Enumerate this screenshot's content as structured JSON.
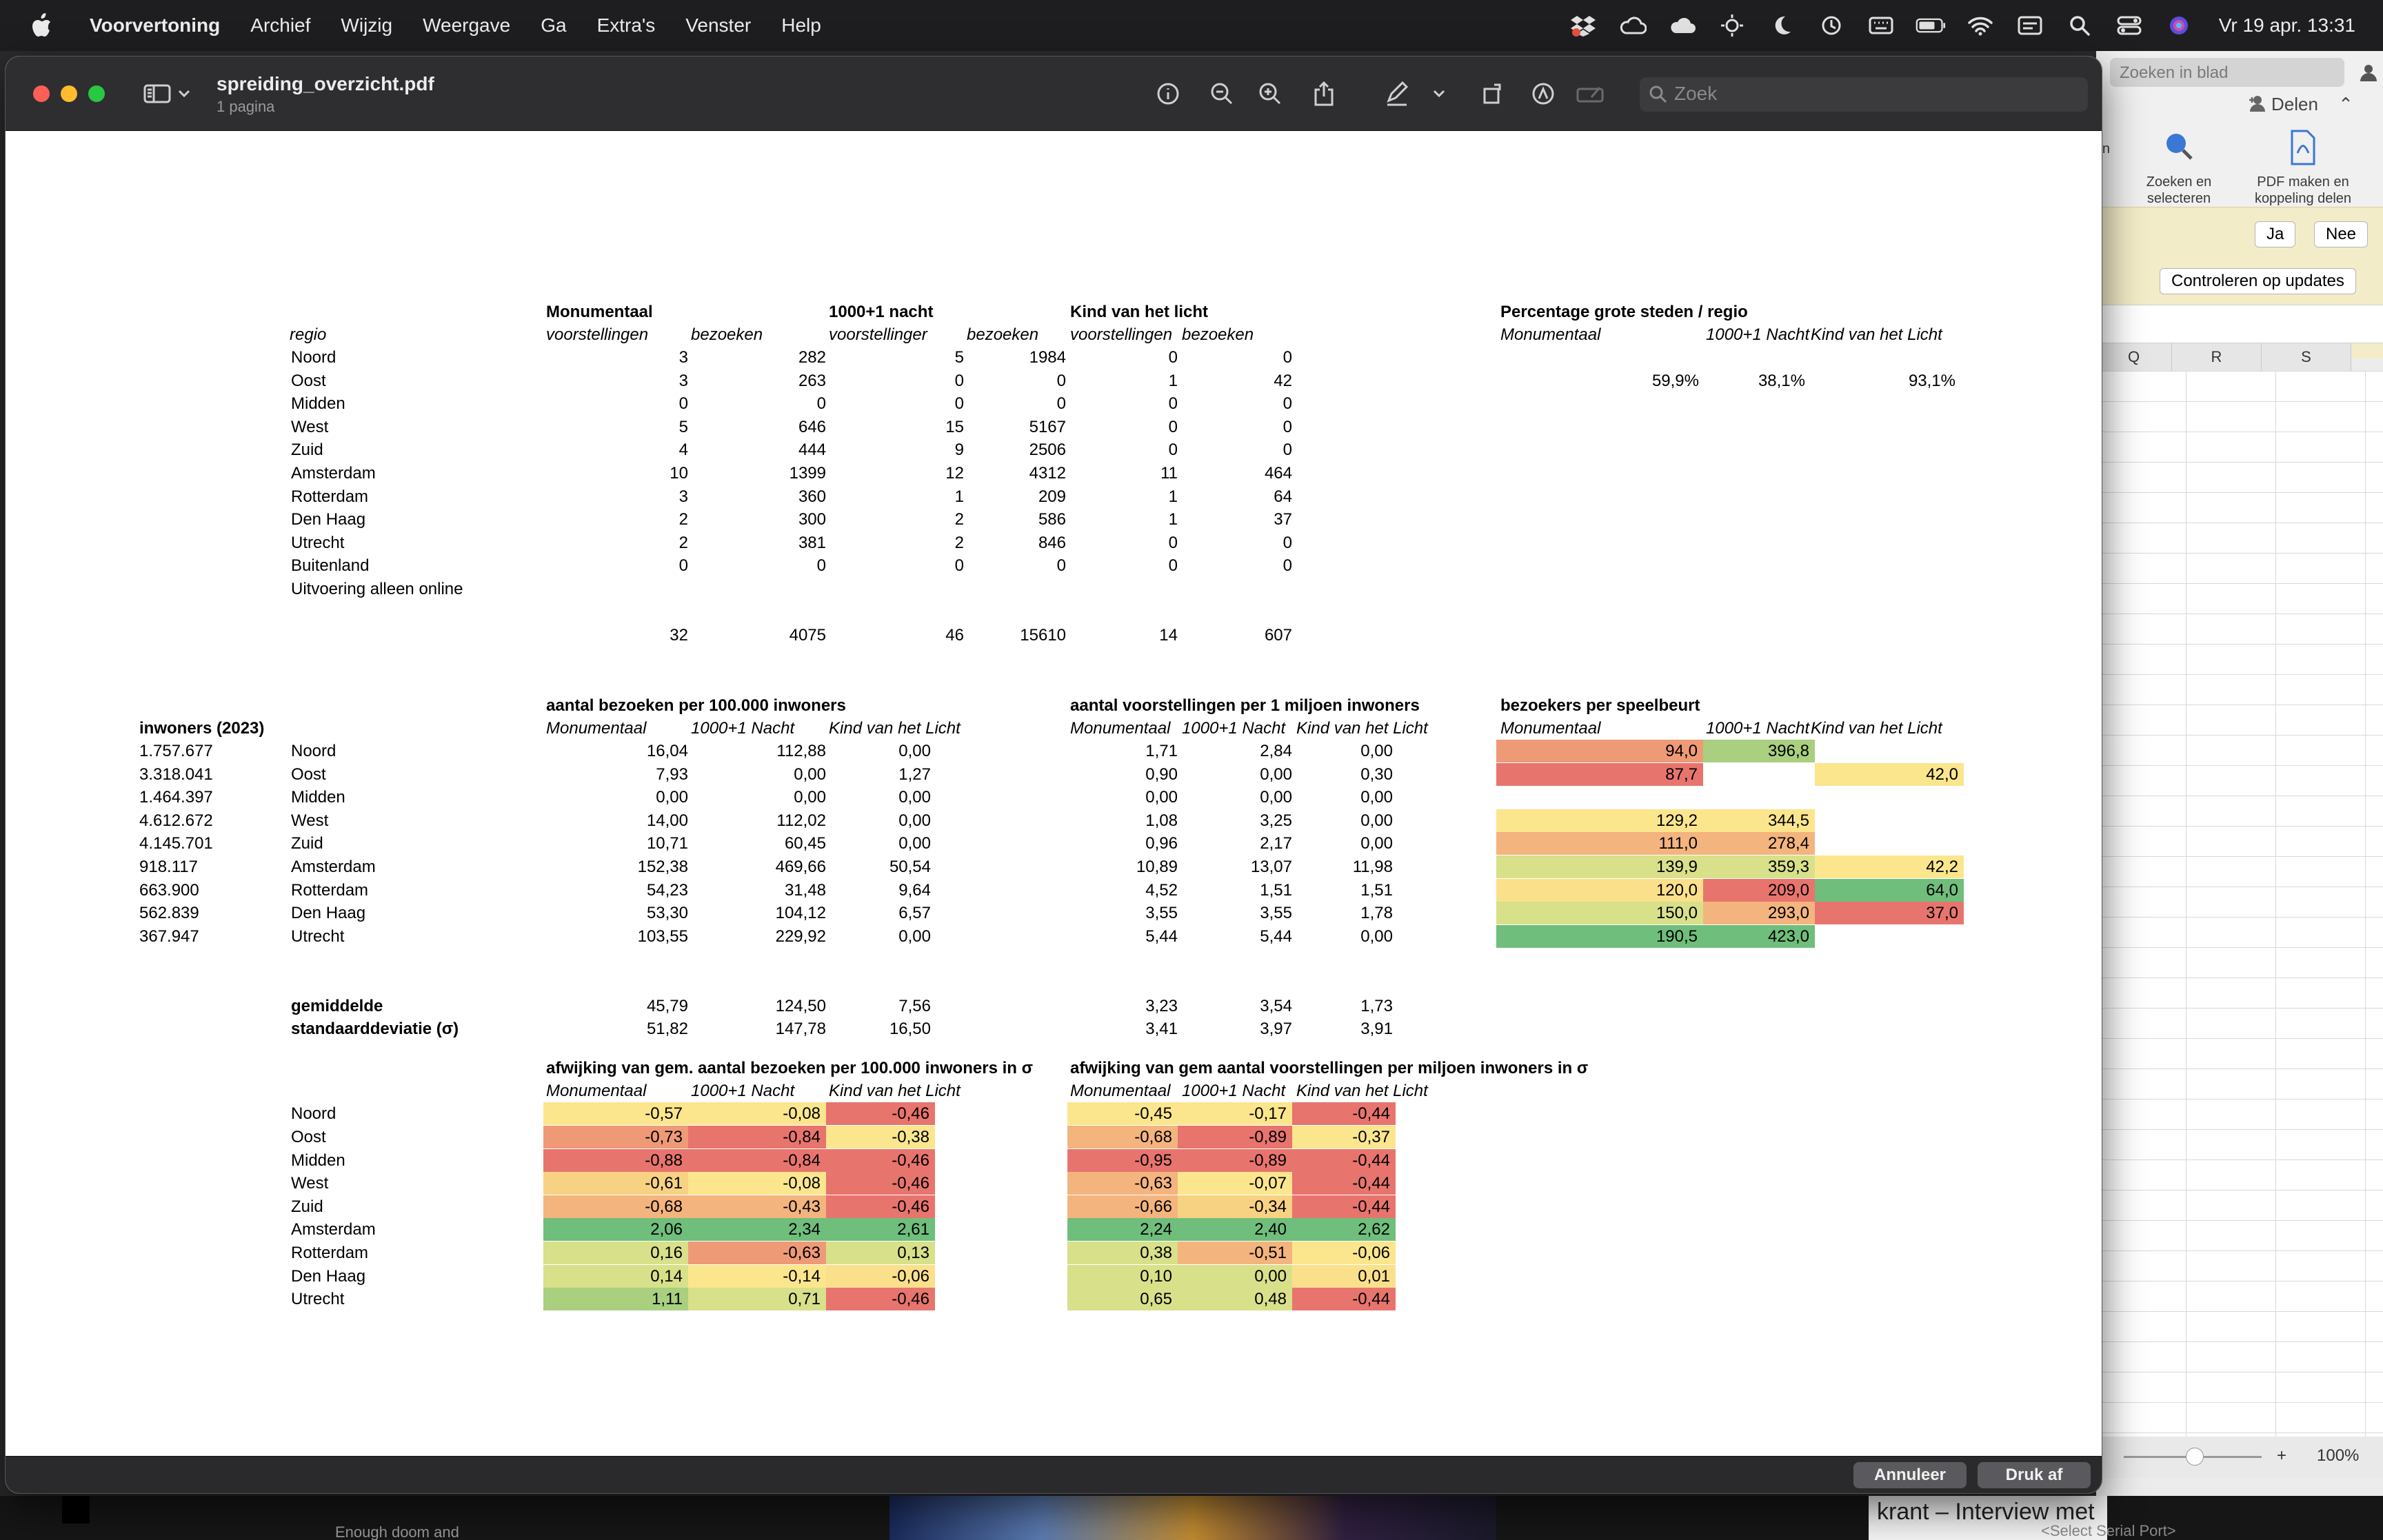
{
  "menubar": {
    "app": "Voorvertoning",
    "items": [
      "Archief",
      "Wijzig",
      "Weergave",
      "Ga",
      "Extra's",
      "Venster",
      "Help"
    ],
    "clock": "Vr 19 apr.  13:31"
  },
  "window": {
    "title": "spreiding_overzicht.pdf",
    "subtitle": "1 pagina",
    "search_placeholder": "Zoek"
  },
  "footer": {
    "cancel": "Annuleer",
    "print": "Druk af"
  },
  "background_excel": {
    "search": "Zoeken in blad",
    "share": "Delen",
    "ribbon_items": [
      "Zoeken en selecteren",
      "PDF maken en koppeling delen"
    ],
    "ribbon_partial": "en ren",
    "yes": "Ja",
    "no": "Nee",
    "update_button": "Controleren op updates",
    "columns": [
      "Q",
      "R",
      "S"
    ],
    "zoom": "100%"
  },
  "background_bottom": {
    "left_text": "Enough doom and",
    "news_text": "krant – Interview met",
    "serial": "<Select Serial Port>"
  },
  "sheet": {
    "top": {
      "group_headers": [
        "Monumentaal",
        "1000+1 nacht",
        "Kind van het licht"
      ],
      "sub_headers": [
        "regio",
        "voorstellingen",
        "bezoeken",
        "voorstellinger",
        "bezoeken",
        "voorstellingen",
        "bezoeken"
      ],
      "rows": [
        {
          "regio": "Noord",
          "v": [
            "3",
            "282",
            "5",
            "1984",
            "0",
            "0"
          ]
        },
        {
          "regio": "Oost",
          "v": [
            "3",
            "263",
            "0",
            "0",
            "1",
            "42"
          ]
        },
        {
          "regio": "Midden",
          "v": [
            "0",
            "0",
            "0",
            "0",
            "0",
            "0"
          ]
        },
        {
          "regio": "West",
          "v": [
            "5",
            "646",
            "15",
            "5167",
            "0",
            "0"
          ]
        },
        {
          "regio": "Zuid",
          "v": [
            "4",
            "444",
            "9",
            "2506",
            "0",
            "0"
          ]
        },
        {
          "regio": "Amsterdam",
          "v": [
            "10",
            "1399",
            "12",
            "4312",
            "11",
            "464"
          ]
        },
        {
          "regio": "Rotterdam",
          "v": [
            "3",
            "360",
            "1",
            "209",
            "1",
            "64"
          ]
        },
        {
          "regio": "Den Haag",
          "v": [
            "2",
            "300",
            "2",
            "586",
            "1",
            "37"
          ]
        },
        {
          "regio": "Utrecht",
          "v": [
            "2",
            "381",
            "2",
            "846",
            "0",
            "0"
          ]
        },
        {
          "regio": "Buitenland",
          "v": [
            "0",
            "0",
            "0",
            "0",
            "0",
            "0"
          ]
        },
        {
          "regio": "Uitvoering alleen online",
          "v": [
            "",
            "",
            "",
            "",
            "",
            ""
          ]
        }
      ],
      "totals": [
        "32",
        "4075",
        "46",
        "15610",
        "14",
        "607"
      ]
    },
    "pct": {
      "title": "Percentage grote steden / regio",
      "headers": [
        "Monumentaal",
        "1000+1 Nacht",
        "Kind van het Licht"
      ],
      "values": [
        "59,9%",
        "38,1%",
        "93,1%"
      ]
    },
    "mid": {
      "inwoners_header": "inwoners (2023)",
      "bezoeken_title": "aantal bezoeken per 100.000 inwoners",
      "voorst_title": "aantal voorstellingen per 1 miljoen inwoners",
      "speelbeurt_title": "bezoekers per speelbeurt",
      "col_headers": [
        "Monumentaal",
        "1000+1 Nacht",
        "Kind van het Licht"
      ],
      "rows": [
        {
          "inw": "1.757.677",
          "regio": "Noord",
          "b": [
            "16,04",
            "112,88",
            "0,00"
          ],
          "v": [
            "1,71",
            "2,84",
            "0,00"
          ],
          "s": [
            "94,0",
            "396,8",
            ""
          ]
        },
        {
          "inw": "3.318.041",
          "regio": "Oost",
          "b": [
            "7,93",
            "0,00",
            "1,27"
          ],
          "v": [
            "0,90",
            "0,00",
            "0,30"
          ],
          "s": [
            "87,7",
            "",
            "42,0"
          ]
        },
        {
          "inw": "1.464.397",
          "regio": "Midden",
          "b": [
            "0,00",
            "0,00",
            "0,00"
          ],
          "v": [
            "0,00",
            "0,00",
            "0,00"
          ],
          "s": [
            "",
            "",
            ""
          ]
        },
        {
          "inw": "4.612.672",
          "regio": "West",
          "b": [
            "14,00",
            "112,02",
            "0,00"
          ],
          "v": [
            "1,08",
            "3,25",
            "0,00"
          ],
          "s": [
            "129,2",
            "344,5",
            ""
          ]
        },
        {
          "inw": "4.145.701",
          "regio": "Zuid",
          "b": [
            "10,71",
            "60,45",
            "0,00"
          ],
          "v": [
            "0,96",
            "2,17",
            "0,00"
          ],
          "s": [
            "111,0",
            "278,4",
            ""
          ]
        },
        {
          "inw": "918.117",
          "regio": "Amsterdam",
          "b": [
            "152,38",
            "469,66",
            "50,54"
          ],
          "v": [
            "10,89",
            "13,07",
            "11,98"
          ],
          "s": [
            "139,9",
            "359,3",
            "42,2"
          ]
        },
        {
          "inw": "663.900",
          "regio": "Rotterdam",
          "b": [
            "54,23",
            "31,48",
            "9,64"
          ],
          "v": [
            "4,52",
            "1,51",
            "1,51"
          ],
          "s": [
            "120,0",
            "209,0",
            "64,0"
          ]
        },
        {
          "inw": "562.839",
          "regio": "Den Haag",
          "b": [
            "53,30",
            "104,12",
            "6,57"
          ],
          "v": [
            "3,55",
            "3,55",
            "1,78"
          ],
          "s": [
            "150,0",
            "293,0",
            "37,0"
          ]
        },
        {
          "inw": "367.947",
          "regio": "Utrecht",
          "b": [
            "103,55",
            "229,92",
            "0,00"
          ],
          "v": [
            "5,44",
            "5,44",
            "0,00"
          ],
          "s": [
            "190,5",
            "423,0",
            ""
          ]
        }
      ],
      "s_colors": [
        [
          "#ef9a77",
          "#a9cf7f",
          null
        ],
        [
          "#e8746e",
          null,
          "#fbe68e"
        ],
        [
          null,
          null,
          null
        ],
        [
          "#fbe68e",
          "#fbe68e",
          null
        ],
        [
          "#f4b47e",
          "#f4b47e",
          null
        ],
        [
          "#d8e08a",
          "#d8e08a",
          "#fbe68e"
        ],
        [
          "#fbe08c",
          "#e8746e",
          "#6fbe7c"
        ],
        [
          "#d8e08a",
          "#f4b47e",
          "#e8746e"
        ],
        [
          "#6fbe7c",
          "#6fbe7c",
          null
        ]
      ],
      "avg_label": "gemiddelde",
      "std_label": "standaarddeviatie (σ)",
      "avg_b": [
        "45,79",
        "124,50",
        "7,56"
      ],
      "avg_v": [
        "3,23",
        "3,54",
        "1,73"
      ],
      "std_b": [
        "51,82",
        "147,78",
        "16,50"
      ],
      "std_v": [
        "3,41",
        "3,97",
        "3,91"
      ]
    },
    "dev": {
      "title_b": "afwijking van gem. aantal bezoeken per 100.000 inwoners in σ",
      "title_v": "afwijking van gem aantal voorstellingen per miljoen inwoners in σ",
      "col_headers": [
        "Monumentaal",
        "1000+1 Nacht",
        "Kind van het Licht"
      ],
      "regios": [
        "Noord",
        "Oost",
        "Midden",
        "West",
        "Zuid",
        "Amsterdam",
        "Rotterdam",
        "Den Haag",
        "Utrecht"
      ],
      "b": [
        [
          "-0,57",
          "-0,08",
          "-0,46"
        ],
        [
          "-0,73",
          "-0,84",
          "-0,38"
        ],
        [
          "-0,88",
          "-0,84",
          "-0,46"
        ],
        [
          "-0,61",
          "-0,08",
          "-0,46"
        ],
        [
          "-0,68",
          "-0,43",
          "-0,46"
        ],
        [
          "2,06",
          "2,34",
          "2,61"
        ],
        [
          "0,16",
          "-0,63",
          "0,13"
        ],
        [
          "0,14",
          "-0,14",
          "-0,06"
        ],
        [
          "1,11",
          "0,71",
          "-0,46"
        ]
      ],
      "v": [
        [
          "-0,45",
          "-0,17",
          "-0,44"
        ],
        [
          "-0,68",
          "-0,89",
          "-0,37"
        ],
        [
          "-0,95",
          "-0,89",
          "-0,44"
        ],
        [
          "-0,63",
          "-0,07",
          "-0,44"
        ],
        [
          "-0,66",
          "-0,34",
          "-0,44"
        ],
        [
          "2,24",
          "2,40",
          "2,62"
        ],
        [
          "0,38",
          "-0,51",
          "-0,06"
        ],
        [
          "0,10",
          "0,00",
          "0,01"
        ],
        [
          "0,65",
          "0,48",
          "-0,44"
        ]
      ],
      "b_colors": [
        [
          "#fbe68e",
          "#fbe68e",
          "#e8746e"
        ],
        [
          "#ef9a77",
          "#e8746e",
          "#fbe68e"
        ],
        [
          "#e8746e",
          "#e8746e",
          "#e8746e"
        ],
        [
          "#f8d283",
          "#fbe68e",
          "#e8746e"
        ],
        [
          "#f4b47e",
          "#f4b47e",
          "#e8746e"
        ],
        [
          "#6fbe7c",
          "#6fbe7c",
          "#6fbe7c"
        ],
        [
          "#d8e08a",
          "#ef9a77",
          "#d8e08a"
        ],
        [
          "#d8e08a",
          "#fbe68e",
          "#fbe08c"
        ],
        [
          "#a9cf7f",
          "#d8e08a",
          "#e8746e"
        ]
      ],
      "v_colors": [
        [
          "#fbe68e",
          "#fbe68e",
          "#e8746e"
        ],
        [
          "#f4b47e",
          "#e8746e",
          "#fbe68e"
        ],
        [
          "#e8746e",
          "#e8746e",
          "#e8746e"
        ],
        [
          "#f4b47e",
          "#fbe68e",
          "#e8746e"
        ],
        [
          "#f4b47e",
          "#f8d283",
          "#e8746e"
        ],
        [
          "#6fbe7c",
          "#6fbe7c",
          "#6fbe7c"
        ],
        [
          "#d8e08a",
          "#f4b47e",
          "#fbe68e"
        ],
        [
          "#d8e08a",
          "#d8e08a",
          "#fbe08c"
        ],
        [
          "#d8e08a",
          "#d8e08a",
          "#e8746e"
        ]
      ]
    }
  }
}
